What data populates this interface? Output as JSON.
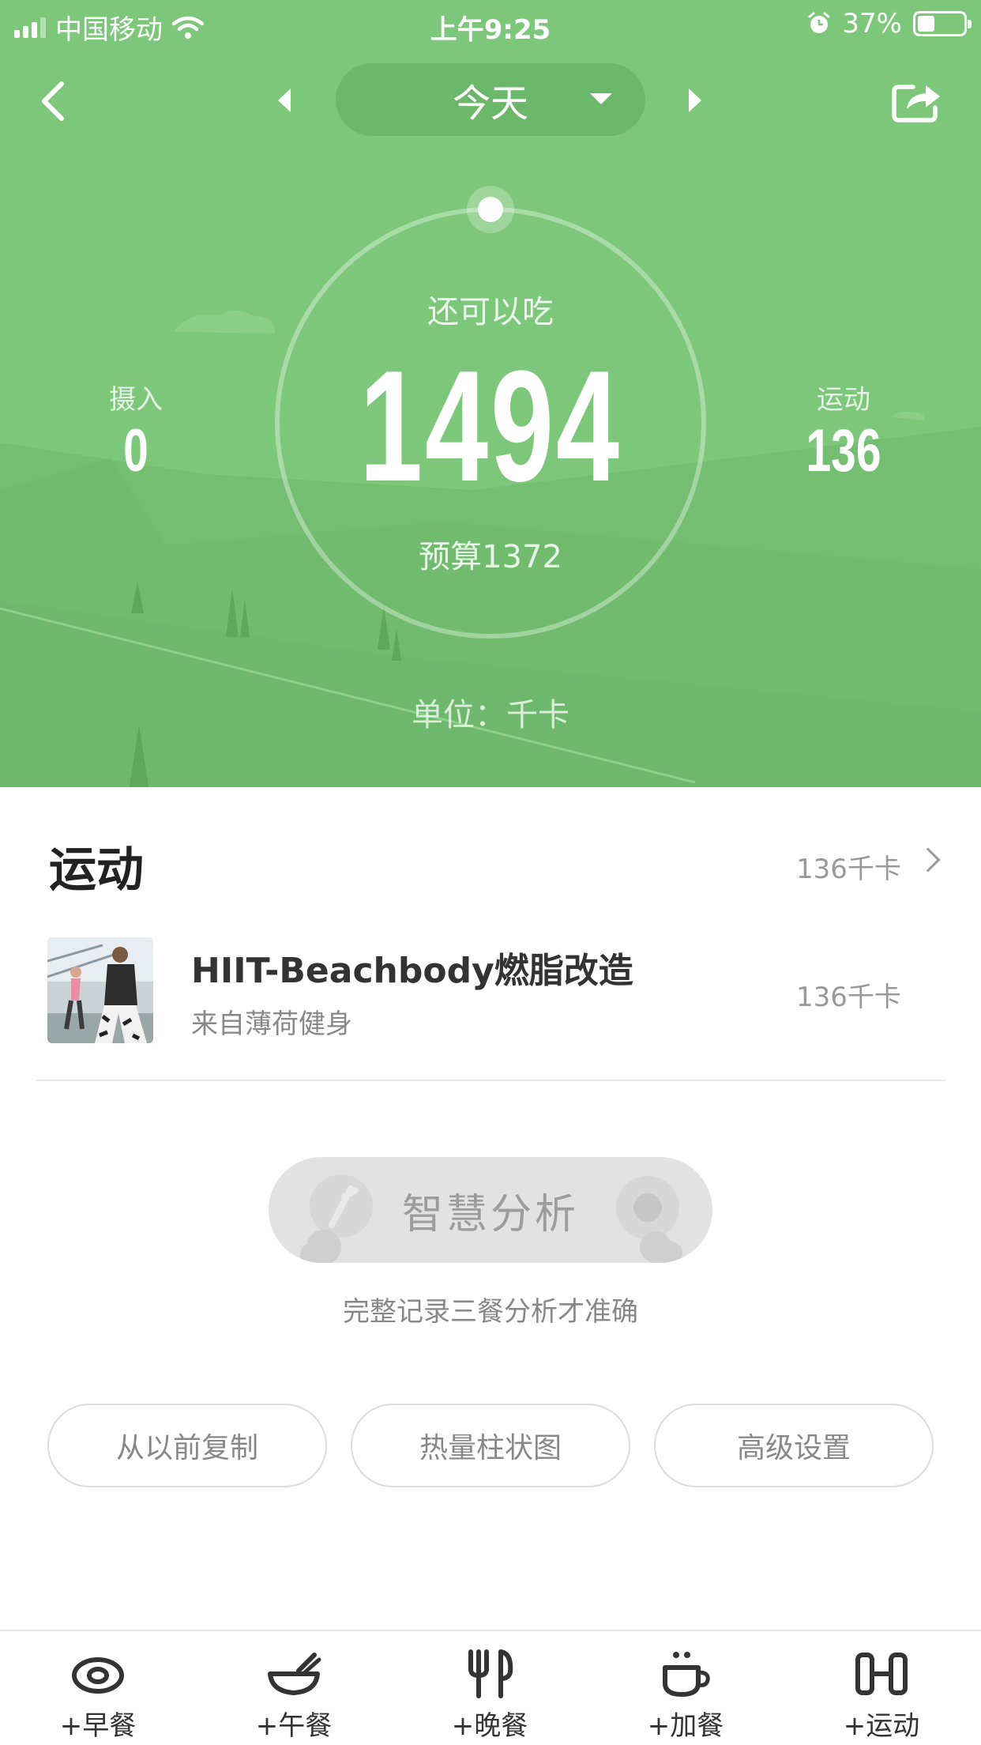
{
  "status_bar": {
    "carrier": "中国移动",
    "time": "上午9:25",
    "battery": "37%",
    "battery_level": 0.37
  },
  "nav": {
    "date_label": "今天"
  },
  "summary": {
    "remain_label": "还可以吃",
    "remain_value": "1494",
    "budget_text": "预算1372",
    "intake_label": "摄入",
    "intake_value": "0",
    "exercise_label": "运动",
    "exercise_value": "136",
    "unit_text": "单位：千卡"
  },
  "exercise_section": {
    "title": "运动",
    "total": "136千卡",
    "items": [
      {
        "name": "HIIT-Beachbody燃脂改造",
        "source": "来自薄荷健身",
        "kcal": "136千卡"
      }
    ]
  },
  "analysis": {
    "button_label": "智慧分析",
    "hint": "完整记录三餐分析才准确"
  },
  "tools": {
    "copy_label": "从以前复制",
    "chart_label": "热量柱状图",
    "settings_label": "高级设置"
  },
  "bottom_bar": {
    "items": [
      {
        "label": "+早餐",
        "icon": "egg-icon"
      },
      {
        "label": "+午餐",
        "icon": "bowl-icon"
      },
      {
        "label": "+晚餐",
        "icon": "fork-knife-icon"
      },
      {
        "label": "+加餐",
        "icon": "cup-icon"
      },
      {
        "label": "+运动",
        "icon": "dumbbell-icon"
      }
    ]
  },
  "colors": {
    "header_green": "#7cc77a",
    "text_dark": "#333333",
    "text_muted": "#999999"
  }
}
